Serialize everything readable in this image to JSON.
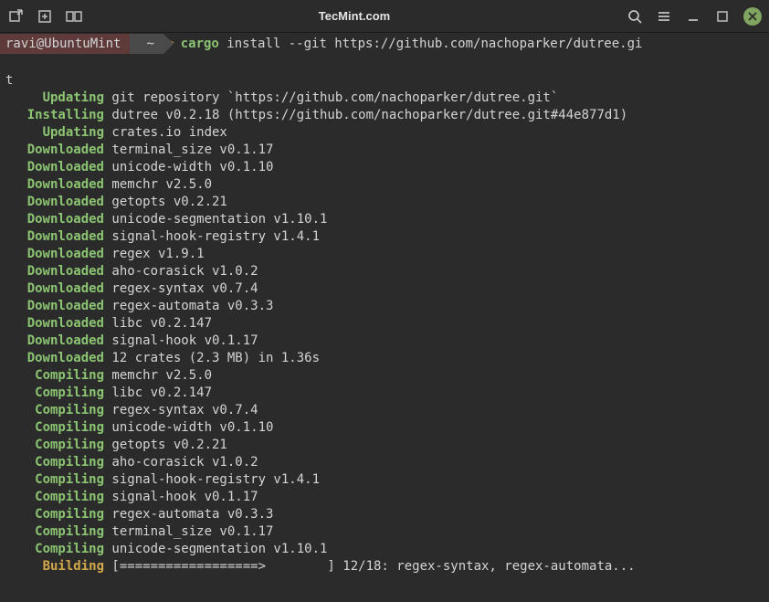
{
  "titlebar": {
    "title": "TecMint.com"
  },
  "prompt": {
    "user": "ravi@UbuntuMint",
    "path": "~",
    "command_main": "cargo",
    "command_rest": " install --git https://github.com/nachoparker/dutree.gi"
  },
  "wrap": "t",
  "lines": [
    {
      "status": "Updating",
      "cls": "green",
      "text": " git repository `https://github.com/nachoparker/dutree.git`"
    },
    {
      "status": "Installing",
      "cls": "green",
      "text": " dutree v0.2.18 (https://github.com/nachoparker/dutree.git#44e877d1)"
    },
    {
      "status": "Updating",
      "cls": "green",
      "text": " crates.io index"
    },
    {
      "status": "Downloaded",
      "cls": "green",
      "text": " terminal_size v0.1.17"
    },
    {
      "status": "Downloaded",
      "cls": "green",
      "text": " unicode-width v0.1.10"
    },
    {
      "status": "Downloaded",
      "cls": "green",
      "text": " memchr v2.5.0"
    },
    {
      "status": "Downloaded",
      "cls": "green",
      "text": " getopts v0.2.21"
    },
    {
      "status": "Downloaded",
      "cls": "green",
      "text": " unicode-segmentation v1.10.1"
    },
    {
      "status": "Downloaded",
      "cls": "green",
      "text": " signal-hook-registry v1.4.1"
    },
    {
      "status": "Downloaded",
      "cls": "green",
      "text": " regex v1.9.1"
    },
    {
      "status": "Downloaded",
      "cls": "green",
      "text": " aho-corasick v1.0.2"
    },
    {
      "status": "Downloaded",
      "cls": "green",
      "text": " regex-syntax v0.7.4"
    },
    {
      "status": "Downloaded",
      "cls": "green",
      "text": " regex-automata v0.3.3"
    },
    {
      "status": "Downloaded",
      "cls": "green",
      "text": " libc v0.2.147"
    },
    {
      "status": "Downloaded",
      "cls": "green",
      "text": " signal-hook v0.1.17"
    },
    {
      "status": "Downloaded",
      "cls": "green",
      "text": " 12 crates (2.3 MB) in 1.36s"
    },
    {
      "status": "Compiling",
      "cls": "green",
      "text": " memchr v2.5.0"
    },
    {
      "status": "Compiling",
      "cls": "green",
      "text": " libc v0.2.147"
    },
    {
      "status": "Compiling",
      "cls": "green",
      "text": " regex-syntax v0.7.4"
    },
    {
      "status": "Compiling",
      "cls": "green",
      "text": " unicode-width v0.1.10"
    },
    {
      "status": "Compiling",
      "cls": "green",
      "text": " getopts v0.2.21"
    },
    {
      "status": "Compiling",
      "cls": "green",
      "text": " aho-corasick v1.0.2"
    },
    {
      "status": "Compiling",
      "cls": "green",
      "text": " signal-hook-registry v1.4.1"
    },
    {
      "status": "Compiling",
      "cls": "green",
      "text": " signal-hook v0.1.17"
    },
    {
      "status": "Compiling",
      "cls": "green",
      "text": " regex-automata v0.3.3"
    },
    {
      "status": "Compiling",
      "cls": "green",
      "text": " terminal_size v0.1.17"
    },
    {
      "status": "Compiling",
      "cls": "green",
      "text": " unicode-segmentation v1.10.1"
    },
    {
      "status": "Building",
      "cls": "yellow",
      "text": " [==================>        ] 12/18: regex-syntax, regex-automata..."
    }
  ]
}
